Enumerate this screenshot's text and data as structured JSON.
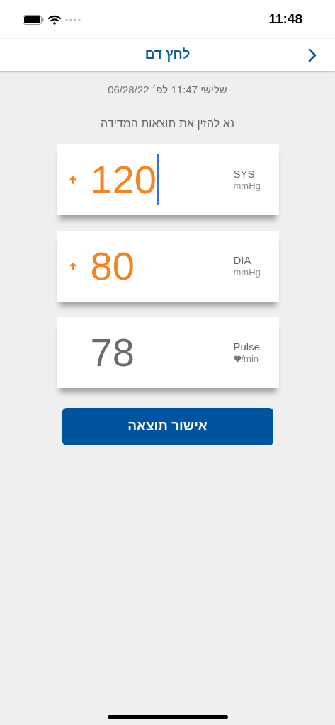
{
  "status_bar": {
    "time": "11:48"
  },
  "nav": {
    "title": "לחץ דם"
  },
  "timestamp": "שלישי 11:47 לפ׳ 06/28/22",
  "instruction": "נא להזין את תוצאות המדידה",
  "readings": [
    {
      "kind": "pressure",
      "value": "120",
      "label": "SYS",
      "unit": "mmHg",
      "elevated": true,
      "focused": true
    },
    {
      "kind": "pressure",
      "value": "80",
      "label": "DIA",
      "unit": "mmHg",
      "elevated": true,
      "focused": false
    },
    {
      "kind": "pulse",
      "value": "78",
      "label": "Pulse",
      "unit": "/min",
      "elevated": false,
      "focused": false
    }
  ],
  "confirm_button": "אישור תוצאה"
}
